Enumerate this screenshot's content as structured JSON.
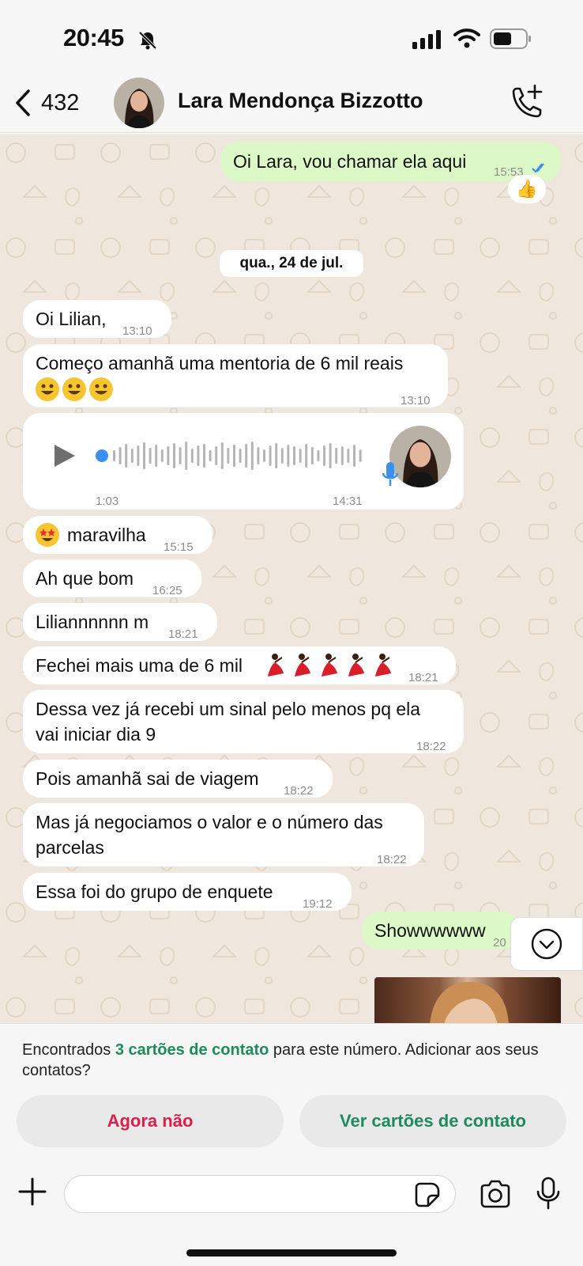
{
  "status_bar": {
    "time": "20:45"
  },
  "header": {
    "back_count": "432",
    "contact_name": "Lara Mendonça Bizzotto"
  },
  "chat": {
    "first_outgoing": {
      "text": "Oi Lara, vou chamar ela aqui",
      "time": "15:53",
      "reaction": "👍"
    },
    "date_separator": "qua., 24 de jul.",
    "messages": [
      {
        "text": "Oi Lilian,",
        "time": "13:10"
      },
      {
        "line1": "Começo amanhã uma mentoria de 6 mil reais",
        "time": "13:10"
      },
      {
        "text": "maravilha",
        "time": "15:15"
      },
      {
        "text": "Ah que bom",
        "time": "16:25"
      },
      {
        "text": "Liliannnnnn m",
        "time": "18:21"
      },
      {
        "text": "Fechei mais uma de 6 mil",
        "time": "18:21"
      },
      {
        "line1": "Dessa vez já recebi um sinal pelo menos pq ela",
        "line2": "vai iniciar dia 9",
        "time": "18:22"
      },
      {
        "text": "Pois amanhã sai de viagem",
        "time": "18:22"
      },
      {
        "line1": "Mas já negociamos o valor e o número das",
        "line2": "parcelas",
        "time": "18:22"
      },
      {
        "text": "Essa foi do grupo de enquete",
        "time": "19:12"
      }
    ],
    "voice_message": {
      "duration": "1:03",
      "time": "14:31"
    },
    "last_outgoing": {
      "text": "Showwwwww",
      "time": "20"
    }
  },
  "banner": {
    "text_before": "Encontrados ",
    "highlight": "3 cartões de contato",
    "text_after": " para este número. Adicionar aos seus contatos?",
    "not_now_label": "Agora não",
    "view_cards_label": "Ver cartões de contato"
  },
  "input": {
    "placeholder": ""
  },
  "colors": {
    "incoming_bubble": "#ffffff",
    "outgoing_bubble": "#dbf8c6",
    "chat_background": "#efe7dd",
    "accent_green": "#1f8a5b",
    "danger_red": "#d8214a",
    "voice_blue": "#3a8ff0"
  }
}
